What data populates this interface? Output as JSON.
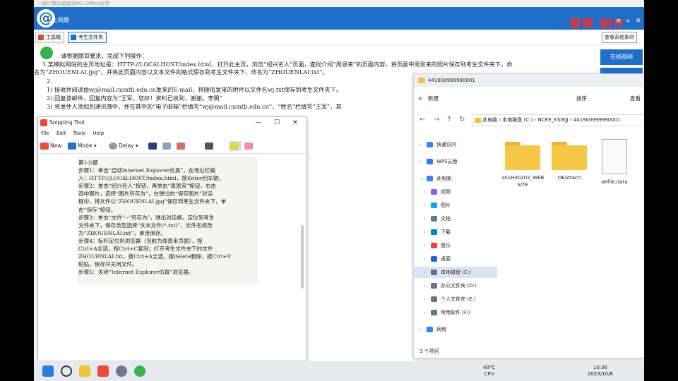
{
  "app": {
    "titlebar_text": "一级计算机基础及MS Office应用",
    "header_title": "上网题",
    "brand": "黄辉 制作",
    "controls": [
      "≡",
      "«",
      "✕"
    ],
    "toolbar": [
      "工具箱",
      "考生文件夹"
    ],
    "side_button": "查看系统素材",
    "side_panel_button": "在线视频"
  },
  "question": {
    "lines": [
      "请根据题目要求，完成下列操作：",
      "1.某模拟网站的主页地址是：HTTP://LOCALHOST/index.html，打开此主页，浏览“绍兴名人”页面，查找介绍“周恩来”的页面内容，将页面中周恩来的照片保存到考生文件夹下，命",
      "名为“ZHOUENLAI.jpg”，并将此页面内容以文本文件的格式保存到考生文件夹下，命名为“ZHOUENLAI.txt”。",
      "2.",
      "1) 接收并阅读由wj@mail.cumtb.edu.cn发来的E-mail，将随信发来的附件以文件名wj.txt保存到考生文件夹下。",
      "2) 回复该邮件，回复内容为“王军，您好！资料已收到，谢谢。李明”",
      "3) 将发件人添加到通讯簿中，并在其中的“电子邮箱”栏填写“wj@mail.cumtb.edu.cn”，“姓名”栏填写“王军”，其"
    ]
  },
  "snipping": {
    "title": "Snipping Tool",
    "window_controls": [
      "—",
      "☐",
      "✕"
    ],
    "menu": [
      "File",
      "Edit",
      "Tools",
      "Help"
    ],
    "tools": {
      "new": "New",
      "mode": "Mode",
      "delay": "Delay"
    },
    "content_lines": [
      "第1小题",
      "步骤1：单击“启动Internet Explorer仿真”，在地址栏输",
      "入：HTTP://LOCALHOST/index.html，按Enter回车键。",
      "步骤2：单击“绍兴名人”按钮，再单击“周恩来”按钮，右击",
      "选中图片，选择“图片另存为”，在弹出的“保存图片”对话",
      "框中，将文件以“ZHOUENLAI.jpg”保存到考生文件夹下，单",
      "击“保存”按钮。",
      "步骤3：单击“文件”--“另存为”，弹出对话框，定位到考生",
      "文件夹下，保存类型选择“文本文件(*.txt)”，文件名修改",
      "为“ZHOUENLAI.txt”，单击保存。",
      "步骤4：标杆定位到浏览器（当前为周恩来页面），按",
      "Ctrl+A全选，按Ctrl+C复制；打开考生文件夹下的文件",
      "ZHOUENLAI.txt，按Ctrl+A全选，按delete删除，按Ctrl+V",
      "粘贴，保存并关闭文件。",
      "步骤5：关闭“Internet Explorer仿真”浏览器。"
    ]
  },
  "explorer": {
    "tab_title": "441900999990001",
    "commands": {
      "new": "新建",
      "sort": "排序",
      "view": "查看"
    },
    "breadcrumb": [
      "此电脑",
      "本地磁盘 (C:)",
      "NCRE_KSWJJ",
      "441900999990001"
    ],
    "nav": [
      {
        "label": "快速访问",
        "color": "#3b82f6",
        "chev": "›"
      },
      {
        "label": "WPS云盘",
        "color": "#2b7de9",
        "chev": "›"
      },
      {
        "label": "此电脑",
        "color": "#3b82f6",
        "chev": "⌄"
      },
      {
        "label": "视频",
        "color": "#8b5cf6",
        "chev": "›"
      },
      {
        "label": "图片",
        "color": "#0ea5e9",
        "chev": "›"
      },
      {
        "label": "文档",
        "color": "#64748b",
        "chev": "›"
      },
      {
        "label": "下载",
        "color": "#0284c7",
        "chev": "›"
      },
      {
        "label": "音乐",
        "color": "#ef4444",
        "chev": "›"
      },
      {
        "label": "桌面",
        "color": "#2563eb",
        "chev": "›"
      },
      {
        "label": "本地磁盘 (C:)",
        "color": "#64748b",
        "chev": "›"
      },
      {
        "label": "办公文件夹 (D:)",
        "color": "#64748b",
        "chev": "›"
      },
      {
        "label": "个人文件夹 (E:)",
        "color": "#64748b",
        "chev": "›"
      },
      {
        "label": "常用软件 (F:)",
        "color": "#64748b",
        "chev": "›"
      },
      {
        "label": "网络",
        "color": "#3b82f6",
        "chev": "›"
      }
    ],
    "selected_nav": "本地磁盘 (C:)",
    "files": [
      {
        "name": "101H00202_WEBSITE",
        "kind": "folder"
      },
      {
        "name": "OEAttach",
        "kind": "folder"
      },
      {
        "name": "oefile.data",
        "kind": "file"
      }
    ],
    "status": "3 个项目"
  },
  "taskbar": {
    "temp": "49°C",
    "temp_label": "CPU",
    "time": "10:36",
    "date": "2023/10/6"
  },
  "colors": {
    "accent": "#1f6fc9",
    "brand": "#ff2a2a",
    "folder": "#f6c846"
  }
}
